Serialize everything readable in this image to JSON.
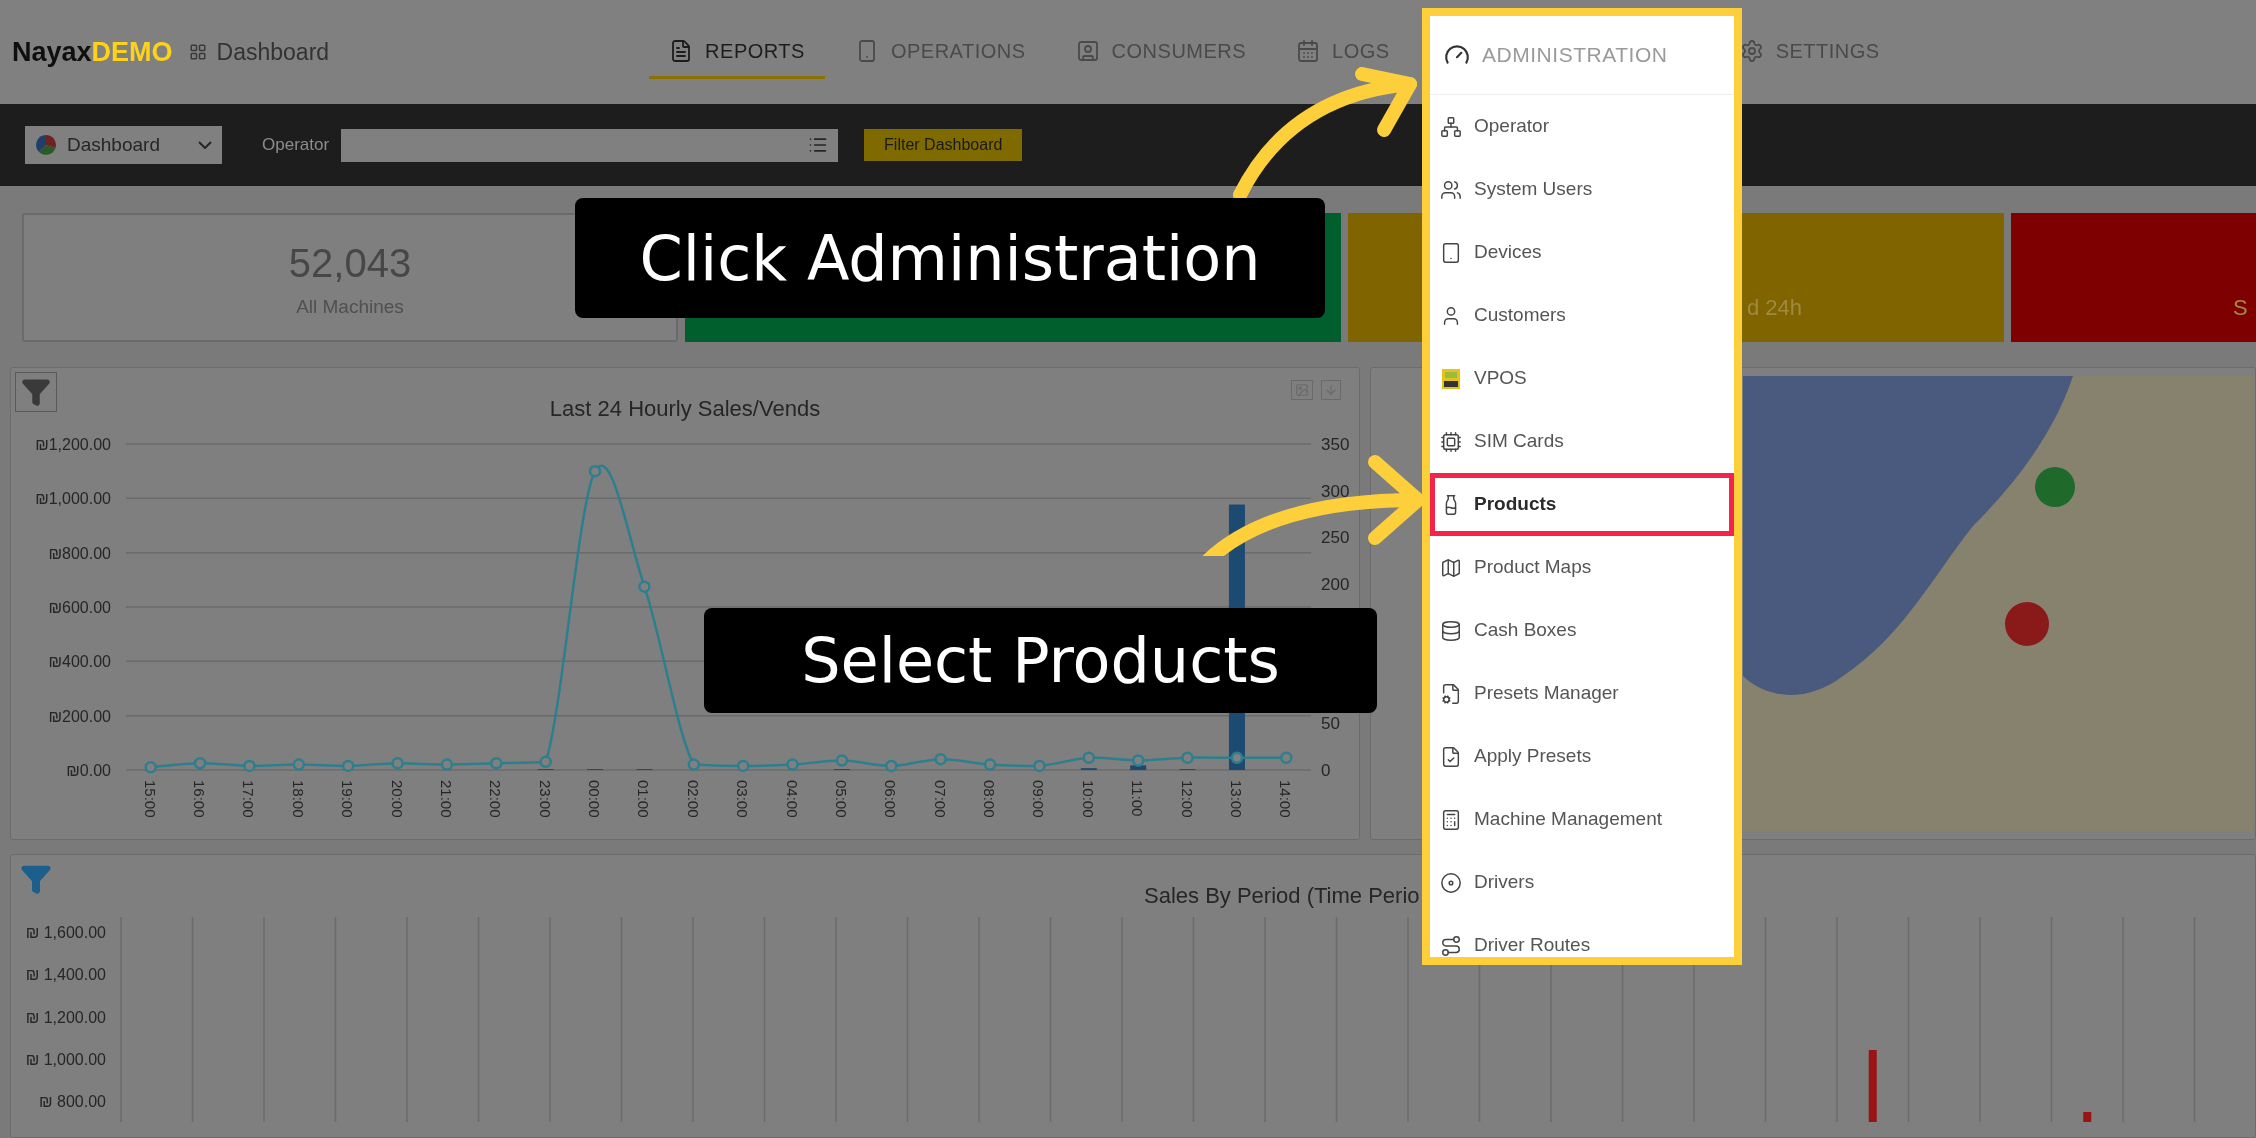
{
  "nav": {
    "logo": {
      "name": "Nayax",
      "badge": "DEMO"
    },
    "breadcrumb": "Dashboard",
    "tabs": [
      {
        "label": "REPORTS",
        "selected": true
      },
      {
        "label": "OPERATIONS",
        "selected": false
      },
      {
        "label": "CONSUMERS",
        "selected": false
      },
      {
        "label": "LOGS",
        "selected": false
      },
      {
        "label": "SETTINGS",
        "selected": false
      }
    ]
  },
  "toolbar": {
    "view_select": "Dashboard",
    "operator_label": "Operator",
    "filter_button": "Filter Dashboard"
  },
  "tiles": [
    {
      "kind": "plain",
      "value": "52,043",
      "label": "All Machines",
      "color": "#7f7f7f"
    },
    {
      "kind": "colored",
      "color": "#005f2c"
    },
    {
      "kind": "colored",
      "color": "#7f6400",
      "label": "d 24h"
    },
    {
      "kind": "colored",
      "color": "#7f0000",
      "label": "S"
    }
  ],
  "hourly_chart": {
    "chart_data": {
      "type": "line",
      "title": "Last 24 Hourly Sales/Vends",
      "categories": [
        "15:00",
        "16:00",
        "17:00",
        "18:00",
        "19:00",
        "20:00",
        "21:00",
        "22:00",
        "23:00",
        "00:00",
        "01:00",
        "02:00",
        "03:00",
        "04:00",
        "05:00",
        "06:00",
        "07:00",
        "08:00",
        "09:00",
        "10:00",
        "11:00",
        "12:00",
        "13:00",
        "14:00"
      ],
      "grid": true,
      "series": [
        {
          "color": "#2e7f8e",
          "marker": "o",
          "values": [
            10,
            25,
            15,
            20,
            15,
            25,
            20,
            25,
            30,
            1100,
            675,
            20,
            15,
            20,
            35,
            15,
            40,
            20,
            15,
            45,
            35,
            45,
            45,
            45
          ]
        },
        {
          "type": "bar",
          "axis": "y2",
          "color": "#1d4a70",
          "values": [
            0,
            0,
            0,
            0,
            0,
            0,
            0,
            0,
            1,
            1,
            1,
            0,
            0,
            0,
            1,
            0,
            0,
            0,
            0,
            2,
            5,
            1,
            285,
            0
          ]
        }
      ],
      "ylim": [
        0,
        1200
      ],
      "yticks": [
        {
          "value": 0,
          "label": "₪0.00"
        },
        {
          "value": 200,
          "label": "₪200.00"
        },
        {
          "value": 400,
          "label": "₪400.00"
        },
        {
          "value": 600,
          "label": "₪600.00"
        },
        {
          "value": 800,
          "label": "₪800.00"
        },
        {
          "value": 1000,
          "label": "₪1,000.00"
        },
        {
          "value": 1200,
          "label": "₪1,200.00"
        }
      ],
      "y2lim": [
        0,
        350
      ],
      "y2ticks": [
        {
          "value": 0,
          "label": "0"
        },
        {
          "value": 50,
          "label": "50"
        },
        {
          "value": 200,
          "label": "200"
        },
        {
          "value": 250,
          "label": "250"
        },
        {
          "value": 300,
          "label": "300"
        },
        {
          "value": 350,
          "label": "350"
        }
      ]
    }
  },
  "period_chart": {
    "title": "Sales By Period (Time Perio",
    "axis_labels": [
      "₪ 1,600.00",
      "₪ 1,400.00",
      "₪ 1,200.00",
      "₪ 1,000.00",
      "₪ 800.00"
    ]
  },
  "admin_menu": {
    "title": "ADMINISTRATION",
    "items": [
      {
        "label": "Operator",
        "selected": false
      },
      {
        "label": "System Users",
        "selected": false
      },
      {
        "label": "Devices",
        "selected": false
      },
      {
        "label": "Customers",
        "selected": false
      },
      {
        "label": "VPOS",
        "selected": false
      },
      {
        "label": "SIM Cards",
        "selected": false
      },
      {
        "label": "Products",
        "selected": true
      },
      {
        "label": "Product Maps",
        "selected": false
      },
      {
        "label": "Cash Boxes",
        "selected": false
      },
      {
        "label": "Presets Manager",
        "selected": false
      },
      {
        "label": "Apply Presets",
        "selected": false
      },
      {
        "label": "Machine Management",
        "selected": false
      },
      {
        "label": "Drivers",
        "selected": false
      },
      {
        "label": "Driver Routes",
        "selected": false
      }
    ]
  },
  "callouts": [
    {
      "text": "Click Administration"
    },
    {
      "text": "Select Products"
    }
  ]
}
